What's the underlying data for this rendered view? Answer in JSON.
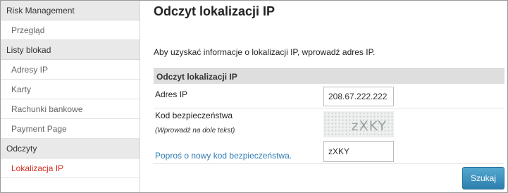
{
  "sidebar": {
    "sections": [
      {
        "title": "Risk Management",
        "items": [
          {
            "label": "Przegląd"
          }
        ]
      },
      {
        "title": "Listy blokad",
        "items": [
          {
            "label": "Adresy IP"
          },
          {
            "label": "Karty"
          },
          {
            "label": "Rachunki bankowe"
          },
          {
            "label": "Payment Page"
          }
        ]
      },
      {
        "title": "Odczyty",
        "items": [
          {
            "label": "Lokalizacja IP",
            "active": true
          }
        ]
      }
    ]
  },
  "main": {
    "title": "Odczyt lokalizacji IP",
    "intro": "Aby uzyskać informacje o lokalizacji IP, wprowadź adres IP.",
    "panel_title": "Odczyt lokalizacji IP",
    "ip_label": "Adres IP",
    "ip_value": "208.67.222.222",
    "security_label": "Kod bezpieczeństwa",
    "security_hint": "(Wprowadź na dole tekst)",
    "captcha_text": "zXKY",
    "new_code_link": "Poproś o nowy kod bezpieczeństwa.",
    "code_value": "zXKY",
    "search_button": "Szukaj"
  },
  "colors": {
    "active_item": "#d0291d",
    "link": "#2e7bb2",
    "button": "#2c7fae"
  }
}
